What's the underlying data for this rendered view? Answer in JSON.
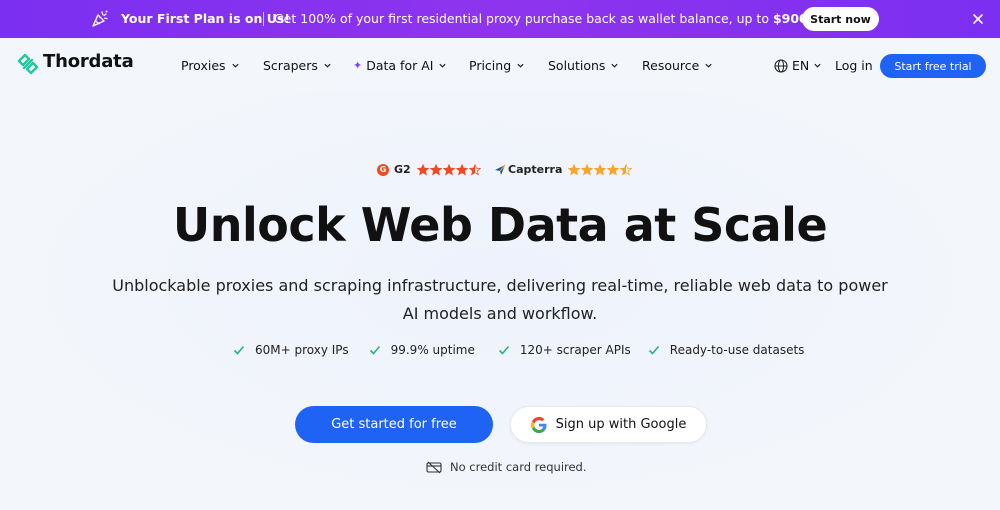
{
  "promo": {
    "title": "Your First Plan is on Us!",
    "message_prefix": "Get 100% of your first residential proxy purchase back as wallet balance, up to ",
    "message_amount": "$900.",
    "cta_label": "Start now",
    "icon": "confetti-icon",
    "close_icon": "close-icon",
    "background_color": "#7b2ff0"
  },
  "brand": {
    "name": "Thordata",
    "logo_icon": "thordata-logo-icon",
    "logo_color": "#1fc9a0"
  },
  "nav": {
    "items": [
      {
        "label": "Proxies"
      },
      {
        "label": "Scrapers"
      },
      {
        "label": "Data for AI",
        "icon": "sparkle-icon"
      },
      {
        "label": "Pricing"
      },
      {
        "label": "Solutions"
      },
      {
        "label": "Resource"
      }
    ],
    "language": "EN",
    "login_label": "Log in",
    "trial_label": "Start free trial",
    "accent_color": "#1f63f5"
  },
  "ratings": {
    "g2_label": "G2",
    "g2_stars": 4.5,
    "capterra_label": "Capterra",
    "capterra_stars": 4.5,
    "g2_star_color": "#ef4a23",
    "capterra_star_color": "#f7a52b"
  },
  "hero": {
    "headline": "Unlock Web Data at Scale",
    "subtitle": "Unblockable proxies and scraping infrastructure, delivering real-time, reliable web data to power AI models and workflow.",
    "features": [
      "60M+ proxy IPs",
      "99.9% uptime",
      "120+ scraper APIs",
      "Ready-to-use datasets"
    ],
    "primary_cta": "Get started for free",
    "google_cta": "Sign up with Google",
    "note": "No credit card required.",
    "check_color": "#1fb388"
  }
}
